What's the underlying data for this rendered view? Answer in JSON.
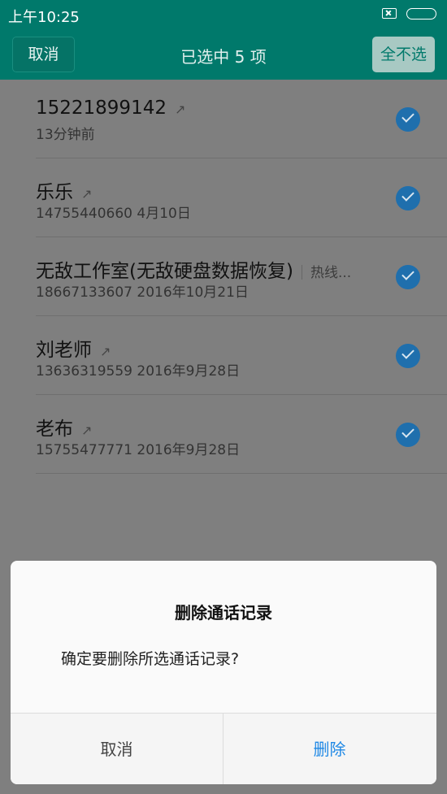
{
  "statusbar": {
    "time": "上午10:25"
  },
  "header": {
    "cancel_label": "取消",
    "title": "已选中  5  项",
    "deselect_all_label": "全不选"
  },
  "calls": [
    {
      "name": "15221899142",
      "extra": "",
      "detail": "13分钟前"
    },
    {
      "name": "乐乐",
      "extra": "",
      "detail": "14755440660  4月10日"
    },
    {
      "name": "无敌工作室(无敌硬盘数据恢复)",
      "extra": "热线...",
      "detail": "18667133607  2016年10月21日"
    },
    {
      "name": "刘老师",
      "extra": "",
      "detail": "13636319559  2016年9月28日"
    },
    {
      "name": "老布",
      "extra": "",
      "detail": "15755477771  2016年9月28日"
    }
  ],
  "dialog": {
    "title": "删除通话记录",
    "message": "确定要删除所选通话记录?",
    "cancel_label": "取消",
    "delete_label": "删除"
  },
  "colors": {
    "header": "#00796b",
    "check": "#1f6fad",
    "delete": "#1e88e5"
  }
}
